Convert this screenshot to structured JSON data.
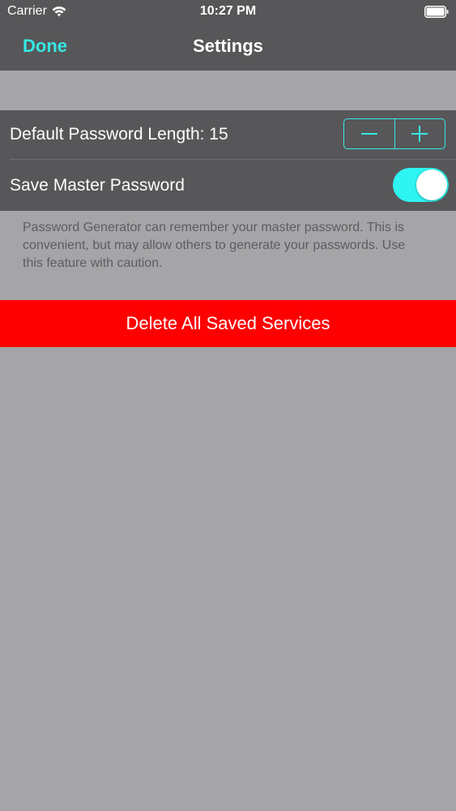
{
  "status_bar": {
    "carrier": "Carrier",
    "time": "10:27 PM",
    "icons": [
      "wifi-icon",
      "battery-icon"
    ]
  },
  "nav": {
    "done_label": "Done",
    "title": "Settings"
  },
  "settings": {
    "password_length_label": "Default Password Length: 15",
    "password_length_value": 15,
    "save_master_label": "Save Master Password",
    "save_master_enabled": true,
    "footer_note": "Password Generator can remember your master password. This is convenient, but may allow others to generate your passwords.  Use this feature with caution."
  },
  "delete_label": "Delete All Saved Services",
  "colors": {
    "accent": "#36e8e4",
    "toggle_on": "#2ef5f1",
    "bar_background": "#575658",
    "page_background": "#a5a4a6",
    "delete_background": "#ff0000"
  }
}
